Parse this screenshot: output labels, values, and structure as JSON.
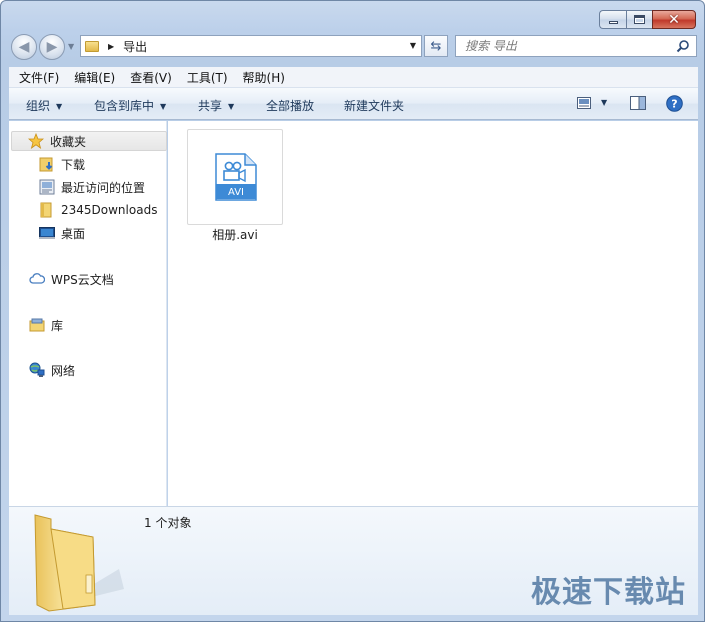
{
  "window": {
    "minimize_icon": "minimize-icon",
    "maximize_icon": "maximize-icon",
    "close_icon": "close-icon"
  },
  "nav": {
    "address_path": "导出",
    "search_placeholder": "搜索 导出"
  },
  "menu": [
    "文件(F)",
    "编辑(E)",
    "查看(V)",
    "工具(T)",
    "帮助(H)"
  ],
  "toolbar": {
    "organize": "组织",
    "include_in_library": "包含到库中",
    "share": "共享",
    "play_all": "全部播放",
    "new_folder": "新建文件夹"
  },
  "sidebar": {
    "favorites": {
      "label": "收藏夹",
      "items": [
        "下载",
        "最近访问的位置",
        "2345Downloads",
        "桌面"
      ]
    },
    "wps": "WPS云文档",
    "libraries": "库",
    "network": "网络"
  },
  "files": [
    {
      "name": "相册.avi",
      "badge": "AVI"
    }
  ],
  "details": {
    "count": "1 个对象"
  },
  "watermark": "极速下载站",
  "colors": {
    "accent": "#3d8ad6",
    "toolbar_text": "#1e395b"
  }
}
